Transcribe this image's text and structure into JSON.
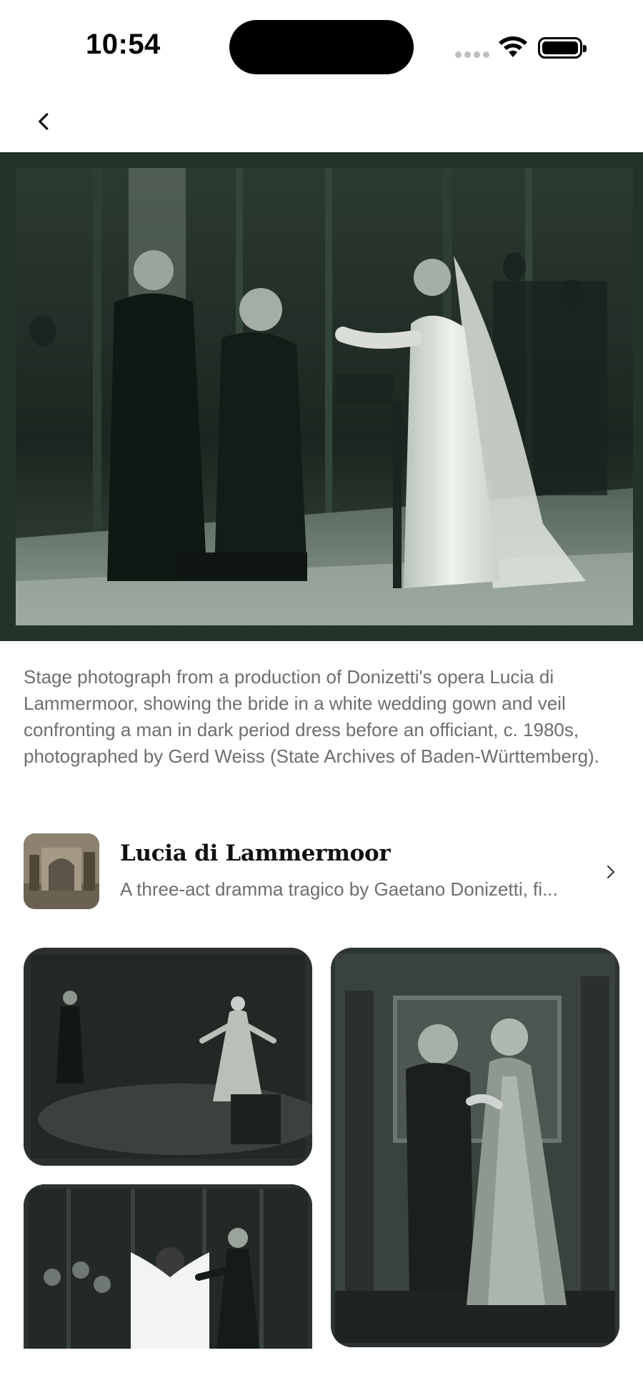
{
  "status_bar": {
    "time": "10:54"
  },
  "nav": {
    "back_icon": "chevron-left-icon"
  },
  "hero_image": {
    "alt": "Stage photograph of the bride in a white wedding gown and veil confronting a man in dark period dress"
  },
  "caption": "Stage photograph from a production of Donizetti's opera Lucia di Lammermoor, showing the bride in a white wedding gown and veil confronting a man in dark period dress before an officiant, c. 1980s, photographed by Gerd Weiss (State Archives of Baden-Württemberg).",
  "related_article": {
    "title": "Lucia di Lammermoor",
    "description": "A three-act dramma tragico by Gaetano Donizetti, fi...",
    "chevron_icon": "chevron-right-icon"
  },
  "gallery": [
    {
      "alt": "Stage scene with a man in dark costume and a woman in a pale flowing gown"
    },
    {
      "alt": "A man and a woman in period costume embracing before an ornate backdrop"
    },
    {
      "alt": "A woman in a white gown with outstretched arms facing a man in dark dress"
    }
  ],
  "colors": {
    "hero_frame": "#22332a",
    "caption_text": "#6e6e6e"
  }
}
